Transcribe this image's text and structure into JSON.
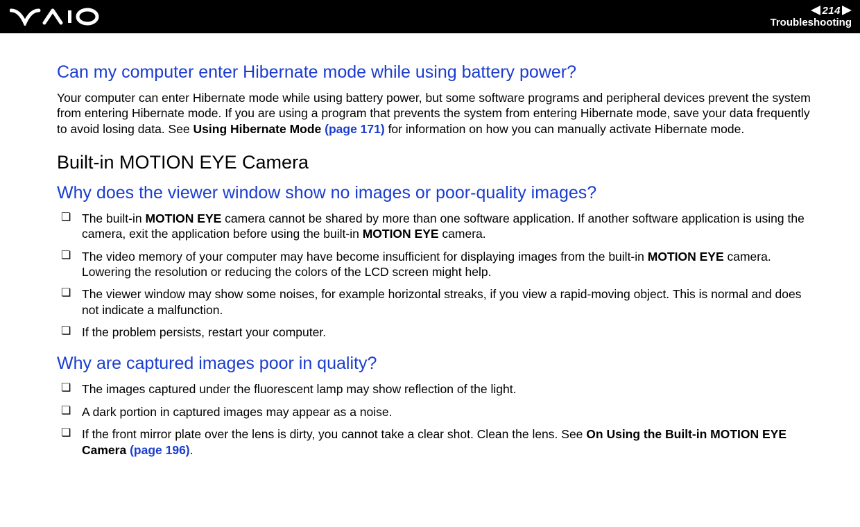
{
  "header": {
    "page_number": "214",
    "section": "Troubleshooting"
  },
  "q1": {
    "title": "Can my computer enter Hibernate mode while using battery power?",
    "body_a": "Your computer can enter Hibernate mode while using battery power, but some software programs and peripheral devices prevent the system from entering Hibernate mode. If you are using a program that prevents the system from entering Hibernate mode, save your data frequently to avoid losing data. See ",
    "body_b_bold": "Using Hibernate Mode ",
    "body_b_link": "(page 171)",
    "body_c": " for information on how you can manually activate Hibernate mode."
  },
  "h2": "Built-in MOTION EYE Camera",
  "q2": {
    "title": "Why does the viewer window show no images or poor-quality images?",
    "items": {
      "i1_a": "The built-in ",
      "i1_b": "MOTION EYE",
      "i1_c": " camera cannot be shared by more than one software application. If another software application is using the camera, exit the application before using the built-in ",
      "i1_d": "MOTION EYE",
      "i1_e": " camera.",
      "i2_a": "The video memory of your computer may have become insufficient for displaying images from the built-in ",
      "i2_b": "MOTION EYE",
      "i2_c": " camera. Lowering the resolution or reducing the colors of the LCD screen might help.",
      "i3": "The viewer window may show some noises, for example horizontal streaks, if you view a rapid-moving object. This is normal and does not indicate a malfunction.",
      "i4": "If the problem persists, restart your computer."
    }
  },
  "q3": {
    "title": "Why are captured images poor in quality?",
    "items": {
      "i1": "The images captured under the fluorescent lamp may show reflection of the light.",
      "i2": "A dark portion in captured images may appear as a noise.",
      "i3_a": "If the front mirror plate over the lens is dirty, you cannot take a clear shot. Clean the lens. See ",
      "i3_b": "On Using the Built-in MOTION EYE Camera ",
      "i3_c": "(page 196)",
      "i3_d": "."
    }
  }
}
